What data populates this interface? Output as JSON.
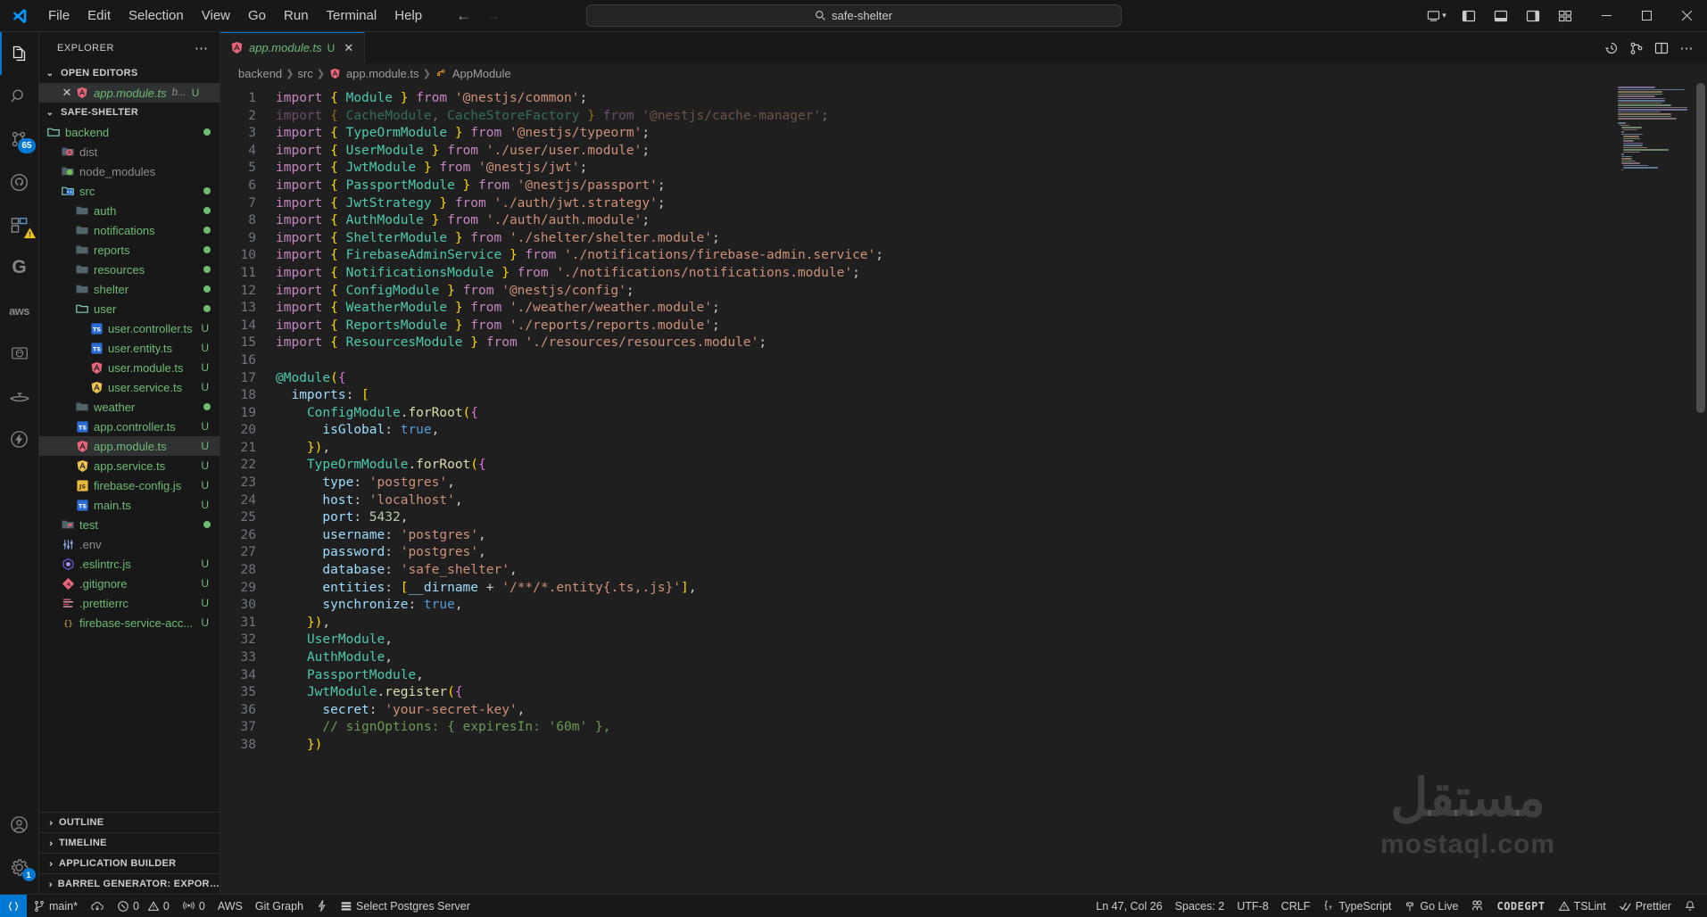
{
  "titlebar": {
    "logo_icon": "vscode-logo-icon",
    "menus": [
      "File",
      "Edit",
      "Selection",
      "View",
      "Go",
      "Run",
      "Terminal",
      "Help"
    ],
    "back_icon": "arrow-left-icon",
    "forward_icon": "arrow-right-icon",
    "command_center": {
      "search_icon": "search-icon",
      "text": "safe-shelter"
    },
    "remote_indicator_icon": "remote-window-icon",
    "remote_chevron_icon": "chevron-down-icon",
    "layout_icons": [
      "toggle-primary-sidebar-icon",
      "toggle-panel-icon",
      "toggle-secondary-sidebar-icon",
      "customize-layout-icon"
    ],
    "window_controls": {
      "minimize": "minimize-icon",
      "maximize": "maximize-icon",
      "close": "close-icon"
    }
  },
  "activitybar": {
    "items": [
      {
        "name": "explorer",
        "icon": "files-icon",
        "active": true,
        "badge": ""
      },
      {
        "name": "search",
        "icon": "search-icon",
        "active": false,
        "badge": ""
      },
      {
        "name": "source-control",
        "icon": "source-control-icon",
        "active": false,
        "badge": "65"
      },
      {
        "name": "github",
        "icon": "github-icon",
        "active": false,
        "badge": ""
      },
      {
        "name": "extensions",
        "icon": "extensions-icon",
        "active": false,
        "badge": "warning"
      },
      {
        "name": "gitlens",
        "icon": "gitlens-g-icon",
        "active": false,
        "badge": ""
      },
      {
        "name": "aws-toolkit",
        "icon": "aws-icon",
        "active": false,
        "badge": ""
      },
      {
        "name": "database",
        "icon": "postgres-elephant-icon",
        "active": false,
        "badge": ""
      },
      {
        "name": "genie",
        "icon": "magic-lamp-icon",
        "active": false,
        "badge": ""
      },
      {
        "name": "thunder-client",
        "icon": "thunder-bolt-icon",
        "active": false,
        "badge": ""
      }
    ],
    "bottom_items": [
      {
        "name": "accounts",
        "icon": "account-icon",
        "badge": ""
      },
      {
        "name": "manage",
        "icon": "gear-icon",
        "badge": "1"
      }
    ]
  },
  "sidebar": {
    "title": "EXPLORER",
    "more_actions_icon": "ellipsis-icon",
    "open_editors": {
      "label": "OPEN EDITORS",
      "expanded": true,
      "items": [
        {
          "close_icon": "close-icon",
          "icon": "angular-red-icon",
          "name": "app.module.ts",
          "path": "b...",
          "status": "U",
          "selected": true
        }
      ]
    },
    "workspace": {
      "label": "SAFE-SHELTER",
      "expanded": true,
      "tree": [
        {
          "depth": 0,
          "name": "backend",
          "type": "folder-open",
          "icon": "folder-open-icon",
          "status": "",
          "dot": true
        },
        {
          "depth": 1,
          "name": "dist",
          "type": "folder-dist",
          "icon": "folder-dist-icon",
          "status": "",
          "dim": true
        },
        {
          "depth": 1,
          "name": "node_modules",
          "type": "folder-node",
          "icon": "folder-node-icon",
          "status": "",
          "dim": true
        },
        {
          "depth": 1,
          "name": "src",
          "type": "folder-src-open",
          "icon": "folder-src-icon",
          "status": "",
          "dot": true
        },
        {
          "depth": 2,
          "name": "auth",
          "type": "folder",
          "icon": "folder-icon",
          "status": "",
          "dot": true
        },
        {
          "depth": 2,
          "name": "notifications",
          "type": "folder",
          "icon": "folder-icon",
          "status": "",
          "dot": true
        },
        {
          "depth": 2,
          "name": "reports",
          "type": "folder",
          "icon": "folder-icon",
          "status": "",
          "dot": true
        },
        {
          "depth": 2,
          "name": "resources",
          "type": "folder",
          "icon": "folder-icon",
          "status": "",
          "dot": true
        },
        {
          "depth": 2,
          "name": "shelter",
          "type": "folder",
          "icon": "folder-icon",
          "status": "",
          "dot": true
        },
        {
          "depth": 2,
          "name": "user",
          "type": "folder-open",
          "icon": "folder-open-icon",
          "status": "",
          "dot": true
        },
        {
          "depth": 3,
          "name": "user.controller.ts",
          "type": "file-ts",
          "icon": "typescript-icon",
          "status": "U"
        },
        {
          "depth": 3,
          "name": "user.entity.ts",
          "type": "file-ts",
          "icon": "typescript-icon",
          "status": "U"
        },
        {
          "depth": 3,
          "name": "user.module.ts",
          "type": "file-ng-red",
          "icon": "angular-red-icon",
          "status": "U"
        },
        {
          "depth": 3,
          "name": "user.service.ts",
          "type": "file-ng-yellow",
          "icon": "angular-yellow-icon",
          "status": "U"
        },
        {
          "depth": 2,
          "name": "weather",
          "type": "folder",
          "icon": "folder-icon",
          "status": "",
          "dot": true
        },
        {
          "depth": 2,
          "name": "app.controller.ts",
          "type": "file-ts",
          "icon": "typescript-icon",
          "status": "U"
        },
        {
          "depth": 2,
          "name": "app.module.ts",
          "type": "file-ng-red",
          "icon": "angular-red-icon",
          "status": "U",
          "selected": true
        },
        {
          "depth": 2,
          "name": "app.service.ts",
          "type": "file-ng-yellow",
          "icon": "angular-yellow-icon",
          "status": "U"
        },
        {
          "depth": 2,
          "name": "firebase-config.js",
          "type": "file-js",
          "icon": "javascript-icon",
          "status": "U"
        },
        {
          "depth": 2,
          "name": "main.ts",
          "type": "file-ts",
          "icon": "typescript-icon",
          "status": "U"
        },
        {
          "depth": 1,
          "name": "test",
          "type": "folder-test",
          "icon": "folder-test-icon",
          "status": "",
          "dot": true
        },
        {
          "depth": 1,
          "name": ".env",
          "type": "file-env",
          "icon": "settings-sliders-icon",
          "status": "",
          "dim": true
        },
        {
          "depth": 1,
          "name": ".eslintrc.js",
          "type": "file-eslint",
          "icon": "eslint-icon",
          "status": "U"
        },
        {
          "depth": 1,
          "name": ".gitignore",
          "type": "file-git",
          "icon": "git-icon",
          "status": "U"
        },
        {
          "depth": 1,
          "name": ".prettierrc",
          "type": "file-prettier",
          "icon": "prettier-icon",
          "status": "U"
        },
        {
          "depth": 1,
          "name": "firebase-service-acc...",
          "type": "file-json",
          "icon": "json-icon",
          "status": "U"
        }
      ]
    },
    "bottom_panels": [
      {
        "label": "OUTLINE",
        "expanded": false
      },
      {
        "label": "TIMELINE",
        "expanded": false
      },
      {
        "label": "APPLICATION BUILDER",
        "expanded": false
      },
      {
        "label": "BARREL GENERATOR: EXPORT V...",
        "expanded": false
      }
    ]
  },
  "editor": {
    "tabs": [
      {
        "icon": "angular-red-icon",
        "label": "app.module.ts",
        "status": "U",
        "close_icon": "close-icon",
        "active": true
      }
    ],
    "toolbar_icons": [
      "timeline-history-icon",
      "source-control-compare-icon",
      "split-editor-icon",
      "more-actions-icon"
    ],
    "breadcrumb": [
      {
        "label": "backend",
        "icon": ""
      },
      {
        "label": "src",
        "icon": ""
      },
      {
        "label": "app.module.ts",
        "icon": "angular-red-icon"
      },
      {
        "label": "AppModule",
        "icon": "symbol-class-icon"
      }
    ],
    "first_line": 1,
    "lines": [
      "import { Module } from '@nestjs/common';",
      "import { CacheModule, CacheStoreFactory } from '@nestjs/cache-manager';",
      "import { TypeOrmModule } from '@nestjs/typeorm';",
      "import { UserModule } from './user/user.module';",
      "import { JwtModule } from '@nestjs/jwt';",
      "import { PassportModule } from '@nestjs/passport';",
      "import { JwtStrategy } from './auth/jwt.strategy';",
      "import { AuthModule } from './auth/auth.module';",
      "import { ShelterModule } from './shelter/shelter.module';",
      "import { FirebaseAdminService } from './notifications/firebase-admin.service';",
      "import { NotificationsModule } from './notifications/notifications.module';",
      "import { ConfigModule } from '@nestjs/config';",
      "import { WeatherModule } from './weather/weather.module';",
      "import { ReportsModule } from './reports/reports.module';",
      "import { ResourcesModule } from './resources/resources.module';",
      "",
      "@Module({",
      "  imports: [",
      "    ConfigModule.forRoot({",
      "      isGlobal: true,",
      "    }),",
      "    TypeOrmModule.forRoot({",
      "      type: 'postgres',",
      "      host: 'localhost',",
      "      port: 5432,",
      "      username: 'postgres',",
      "      password: 'postgres',",
      "      database: 'safe_shelter',",
      "      entities: [__dirname + '/**/*.entity{.ts,.js}'],",
      "      synchronize: true,",
      "    }),",
      "    UserModule,",
      "    AuthModule,",
      "    PassportModule,",
      "    JwtModule.register({",
      "      secret: 'your-secret-key',",
      "      // signOptions: { expiresIn: '60m' },",
      "    })"
    ],
    "watermark": {
      "arabic": "مستقل",
      "latin": "mostaql.com"
    }
  },
  "statusbar": {
    "left": [
      {
        "name": "remote-indicator",
        "icon": "remote-icon",
        "label": ""
      },
      {
        "name": "branch",
        "icon": "git-branch-icon",
        "label": "main*"
      },
      {
        "name": "sync-changes",
        "icon": "cloud-sync-icon",
        "label": ""
      },
      {
        "name": "errors",
        "icon": "error-circle-icon",
        "label": "0"
      },
      {
        "name": "warnings",
        "icon": "warning-triangle-icon",
        "label": "0"
      },
      {
        "name": "ports",
        "icon": "radio-tower-icon",
        "label": "0"
      },
      {
        "name": "aws",
        "icon": "",
        "label": "AWS"
      },
      {
        "name": "git-graph",
        "icon": "",
        "label": "Git Graph"
      },
      {
        "name": "thunder-client",
        "icon": "bolt-icon",
        "label": ""
      },
      {
        "name": "postgres-server",
        "icon": "database-icon",
        "label": "Select Postgres Server"
      }
    ],
    "right": [
      {
        "name": "cursor-position",
        "icon": "",
        "label": "Ln 47, Col 26"
      },
      {
        "name": "indentation",
        "icon": "",
        "label": "Spaces: 2"
      },
      {
        "name": "encoding",
        "icon": "",
        "label": "UTF-8"
      },
      {
        "name": "eol",
        "icon": "",
        "label": "CRLF"
      },
      {
        "name": "language-mode",
        "icon": "ts-brackets-icon",
        "label": "TypeScript"
      },
      {
        "name": "go-live",
        "icon": "broadcast-icon",
        "label": "Go Live"
      },
      {
        "name": "live-share",
        "icon": "live-share-icon",
        "label": ""
      },
      {
        "name": "codegpt",
        "icon": "",
        "label": "CODEGPT"
      },
      {
        "name": "tslint",
        "icon": "warning-triangle-icon",
        "label": "TSLint"
      },
      {
        "name": "prettier",
        "icon": "check-icon",
        "label": "Prettier"
      },
      {
        "name": "notifications",
        "icon": "bell-icon",
        "label": ""
      }
    ]
  },
  "colors": {
    "accent": "#0078d4",
    "editor_bg": "#1f1f1f",
    "chrome_bg": "#181818",
    "text": "#cccccc",
    "git_untracked": "#73c991"
  }
}
